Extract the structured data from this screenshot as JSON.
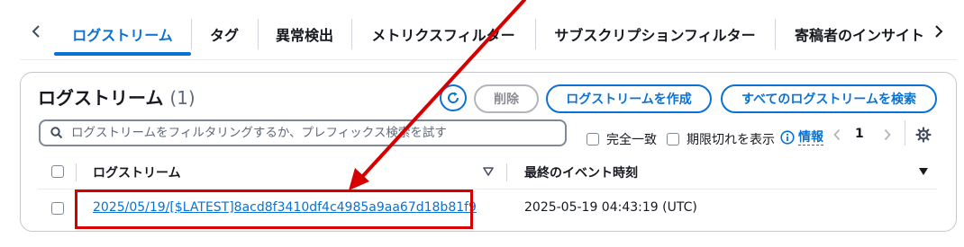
{
  "tabs": [
    {
      "label": "ログストリーム",
      "active": true
    },
    {
      "label": "タグ",
      "active": false
    },
    {
      "label": "異常検出",
      "active": false
    },
    {
      "label": "メトリクスフィルター",
      "active": false
    },
    {
      "label": "サブスクリプションフィルター",
      "active": false
    },
    {
      "label": "寄稿者のインサイト",
      "active": false
    }
  ],
  "panel": {
    "title": "ログストリーム",
    "count": "(1)",
    "delete_label": "削除",
    "create_label": "ログストリームを作成",
    "search_all_label": "すべてのログストリームを検索"
  },
  "filter": {
    "placeholder": "ログストリームをフィルタリングするか、プレフィックス検索を試す",
    "exact_match_label": "完全一致",
    "show_expired_label": "期限切れを表示",
    "info_label": "情報",
    "page_number": "1"
  },
  "table": {
    "columns": [
      "ログストリーム",
      "最終のイベント時刻"
    ],
    "rows": [
      {
        "stream": "2025/05/19/[$LATEST]8acd8f3410df4c4985a9aa67d18b81f9",
        "last_event": "2025-05-19 04:43:19 (UTC)"
      }
    ]
  },
  "colors": {
    "accent": "#0972d3",
    "annotation": "#d70000",
    "text": "#16191f",
    "disabled": "#8c8c94"
  },
  "icons": [
    "chevron-left-icon",
    "chevron-right-icon",
    "refresh-icon",
    "search-icon",
    "info-icon",
    "gear-icon",
    "sort-icon",
    "sort-descending-icon",
    "annotation-arrow"
  ]
}
